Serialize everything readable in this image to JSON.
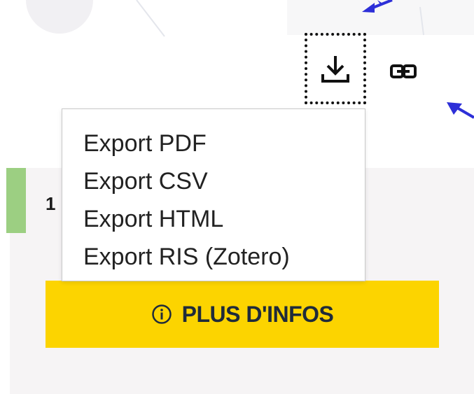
{
  "toolbar": {
    "download_icon": "download-icon",
    "link_icon": "link-icon"
  },
  "export_menu": {
    "items": [
      {
        "label": "Export PDF"
      },
      {
        "label": "Export CSV"
      },
      {
        "label": "Export HTML"
      },
      {
        "label": "Export RIS (Zotero)"
      }
    ]
  },
  "card": {
    "number": "1",
    "accent_color": "#9ccf82",
    "more_info_label": "PLUS D'INFOS",
    "more_info_icon": "info-icon",
    "button_color": "#fcd400"
  },
  "colors": {
    "arrow": "#2d2fd8",
    "card_background": "#f6f4f5"
  }
}
